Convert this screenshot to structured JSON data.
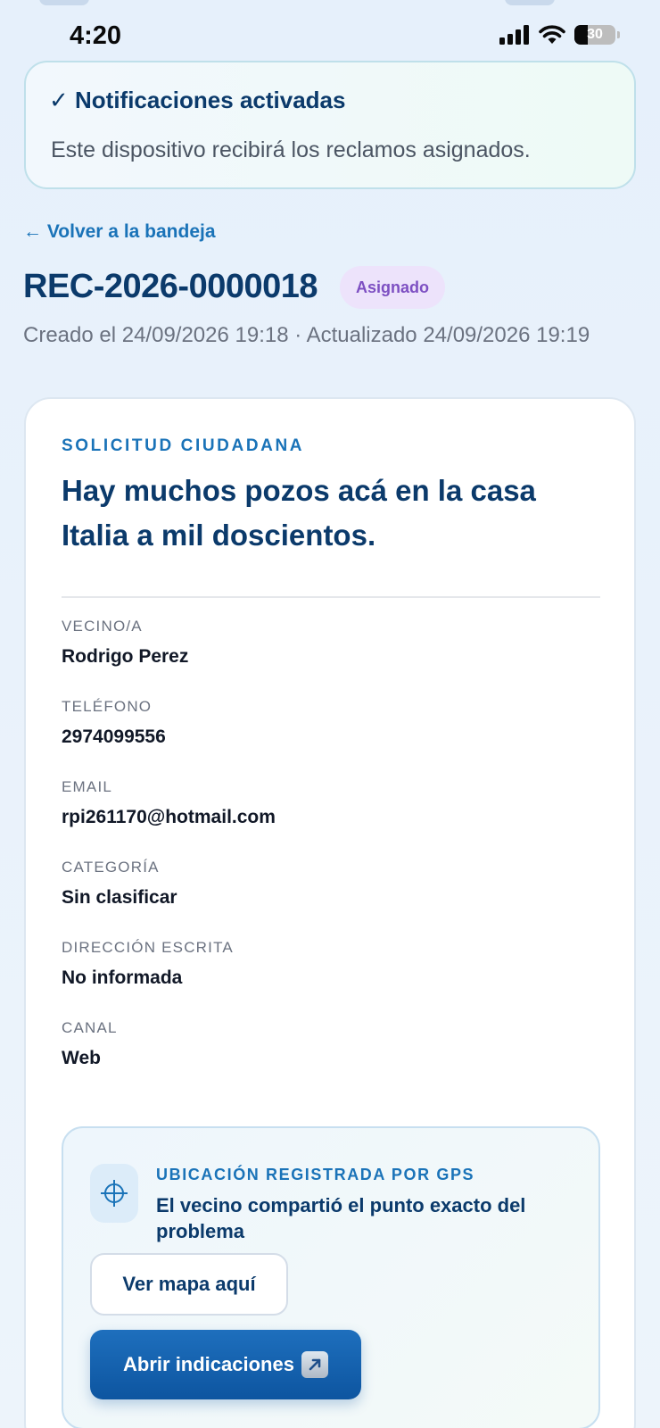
{
  "status_bar": {
    "time": "4:20",
    "battery": "30"
  },
  "notification": {
    "title": "✓ Notificaciones activadas",
    "text": "Este dispositivo recibirá los reclamos asignados."
  },
  "nav": {
    "back_label": "← Volver a la bandeja"
  },
  "claim": {
    "id": "REC-2026-0000018",
    "status": "Asignado",
    "meta": "Creado el 24/09/2026 19:18 · Actualizado 24/09/2026 19:19",
    "status_color": "#7d4fc2"
  },
  "request": {
    "eyebrow": "SOLICITUD CIUDADANA",
    "text": "Hay muchos pozos acá en la casa Italia a mil doscientos."
  },
  "fields": [
    {
      "label": "VECINO/A",
      "value": "Rodrigo Perez"
    },
    {
      "label": "TELÉFONO",
      "value": "2974099556"
    },
    {
      "label": "EMAIL",
      "value": "rpi261170@hotmail.com"
    },
    {
      "label": "CATEGORÍA",
      "value": "Sin clasificar"
    },
    {
      "label": "DIRECCIÓN ESCRITA",
      "value": "No informada"
    },
    {
      "label": "CANAL",
      "value": "Web"
    }
  ],
  "gps": {
    "icon": "crosshair-icon",
    "eyebrow": "UBICACIÓN REGISTRADA POR GPS",
    "text": "El vecino compartió el punto exacto del problema",
    "view_map_label": "Ver mapa aquí",
    "directions_label": "Abrir indicaciones",
    "accent": "#1a73b8"
  }
}
